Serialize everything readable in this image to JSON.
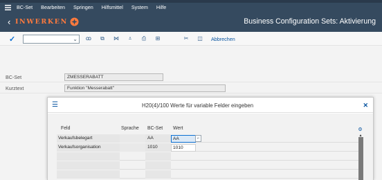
{
  "menubar": {
    "items": [
      "BC-Set",
      "Bearbeiten",
      "Springen",
      "Hilfsmittel",
      "System",
      "Hilfe"
    ]
  },
  "shell": {
    "logo_text": "INWERKEN",
    "title": "Business Configuration Sets: Aktivierung"
  },
  "toolbar": {
    "command_value": "",
    "cancel_label": "Abbrechen",
    "icons": [
      "search-icon",
      "search-next-icon",
      "hierarchy-icon",
      "filter-icon",
      "print-icon",
      "details-icon",
      "tools-icon",
      "display-icon"
    ]
  },
  "form": {
    "bcset_label": "BC-Set",
    "bcset_value": "ZMESSERABATT",
    "kurztext_label": "Kurztext",
    "kurztext_value": "Funktion \"Messerabatt\""
  },
  "dialog": {
    "title": "H20(4)/100 Werte für variable Felder eingeben",
    "columns": [
      "Feld",
      "Sprache",
      "BC-Set",
      "Wert"
    ],
    "rows": [
      {
        "feld": "Verkaufsbelegart",
        "sprache": "",
        "bcset": "AA",
        "wert": "AA"
      },
      {
        "feld": "Verkaufsorganisation",
        "sprache": "",
        "bcset": "1010",
        "wert": "1010"
      }
    ]
  },
  "colors": {
    "shell_bg": "#354a5f",
    "accent": "#0a6ed1",
    "logo": "#ff7a3d"
  }
}
